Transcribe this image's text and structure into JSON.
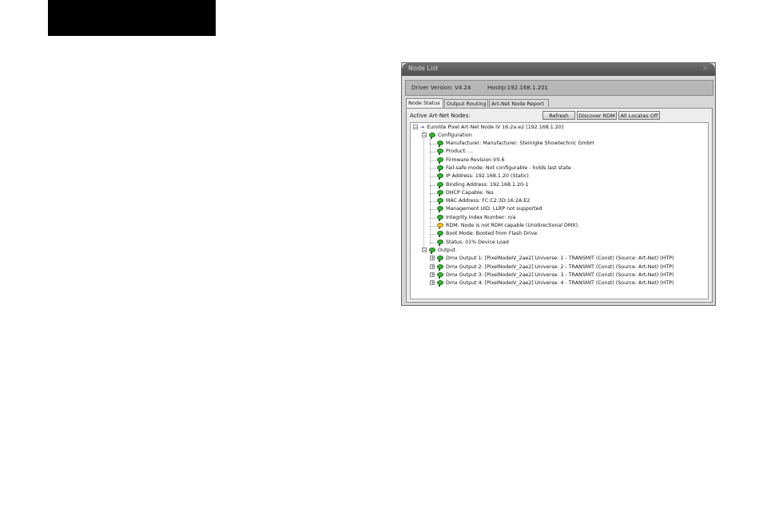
{
  "window": {
    "title": "Node List",
    "close_symbol": "×"
  },
  "info": {
    "driver_version": "Driver Version: V4.24",
    "host_ip": "HostIp:192.168.1.201"
  },
  "tabs": [
    "Node Status",
    "Output Routing",
    "Art-Net Node Report"
  ],
  "active_nodes_label": "Active Art-Net Nodes:",
  "buttons": {
    "refresh": "Refresh",
    "discover_rdm": "Discover RDM",
    "all_locates_off": "All Locates Off"
  },
  "tree": {
    "root": "Eurolite Pixel Art-Net Node IV 16:2a:e2 [192.168.1.20]",
    "configuration_label": "Configuration",
    "configuration_items": [
      "Manufacturer: Manufacturer: Steinigke Showtechnic GmbH",
      "Product: ...",
      "Firmware Revision V0.6",
      "Fail-safe mode: Not configurable - holds last state",
      "IP Address: 192.168.1.20 (Static)",
      "Binding Address: 192.168.1.20-1",
      "DHCP Capable: Yes",
      "MAC Address: FC:C2:3D:16:2A:E2",
      "Management UID: LLRP not supported",
      "Integrity Index Number: n/a",
      "RDM: Node is not RDM capable (Unidirectional DMX).",
      "Boot Mode: Booted from Flash Drive.",
      "Status: 01% Device Load"
    ],
    "output_label": "Output",
    "output_items": [
      "Dmx Output 1: [PixelNodeIV_2ae2] Universe: 1  - TRANSMIT   (Const) (Source: Art-Net) (HTP)",
      "Dmx Output 2: [PixelNodeIV_2ae2] Universe: 2  - TRANSMIT   (Const) (Source: Art-Net) (HTP)",
      "Dmx Output 3: [PixelNodeIV_2ae2] Universe: 3  - TRANSMIT   (Const) (Source: Art-Net) (HTP)",
      "Dmx Output 4: [PixelNodeIV_2ae2] Universe: 4  - TRANSMIT   (Const) (Source: Art-Net) (HTP)"
    ],
    "expander_collapsed": "+",
    "expander_expanded": "−",
    "arrow_symbol": "→"
  }
}
